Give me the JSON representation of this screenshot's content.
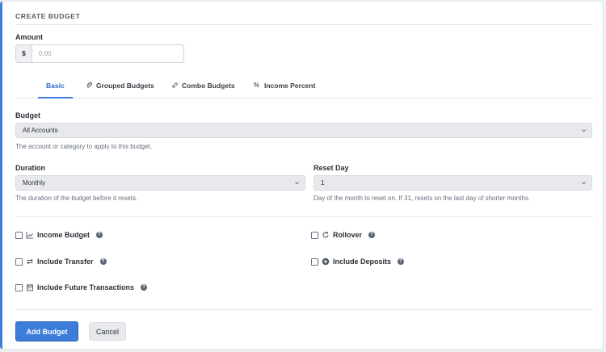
{
  "card": {
    "title": "CREATE BUDGET"
  },
  "amount": {
    "label": "Amount",
    "prefix": "$",
    "placeholder": "0.00"
  },
  "tabs": [
    {
      "label": "Basic",
      "icon": "none",
      "active": true
    },
    {
      "label": "Grouped Budgets",
      "icon": "paperclip-icon",
      "active": false
    },
    {
      "label": "Combo Budgets",
      "icon": "link-icon",
      "active": false
    },
    {
      "label": "Income Percent",
      "icon": "percent-icon",
      "active": false
    }
  ],
  "budget": {
    "label": "Budget",
    "value": "All Accounts",
    "help": "The account or category to apply to this budget."
  },
  "duration": {
    "label": "Duration",
    "value": "Monthly",
    "help": "The duration of the budget before it resets."
  },
  "reset_day": {
    "label": "Reset Day",
    "value": "1",
    "help": "Day of the month to reset on. If 31, resets on the last day of shorter months."
  },
  "options": [
    {
      "label": "Income Budget",
      "icon": "chart-line-icon"
    },
    {
      "label": "Rollover",
      "icon": "refresh-icon"
    },
    {
      "label": "Include Transfer",
      "icon": "exchange-icon"
    },
    {
      "label": "Include Deposits",
      "icon": "plus-circle-icon"
    },
    {
      "label": "Include Future Transactions",
      "icon": "calendar-icon"
    }
  ],
  "actions": {
    "submit": "Add Budget",
    "cancel": "Cancel"
  },
  "colors": {
    "accent": "#3b7dd8",
    "field_bg": "#e7e9ed"
  }
}
